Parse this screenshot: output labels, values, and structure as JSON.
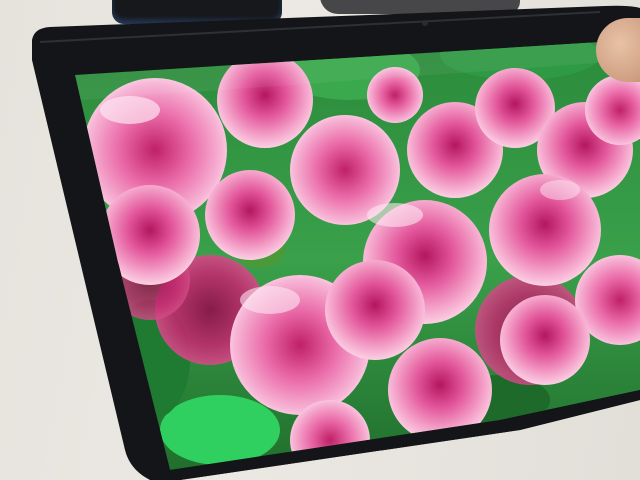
{
  "scene": {
    "subject": "tablet-display",
    "content": "pink-roses",
    "colors": {
      "wall": "#e6e2dc",
      "bezel": "#141518",
      "rose_light": "#f7b6d6",
      "rose_mid": "#e2559a",
      "rose_deep": "#b3165e",
      "leaf": "#2fa84a",
      "leaf_dark": "#146a28"
    }
  }
}
